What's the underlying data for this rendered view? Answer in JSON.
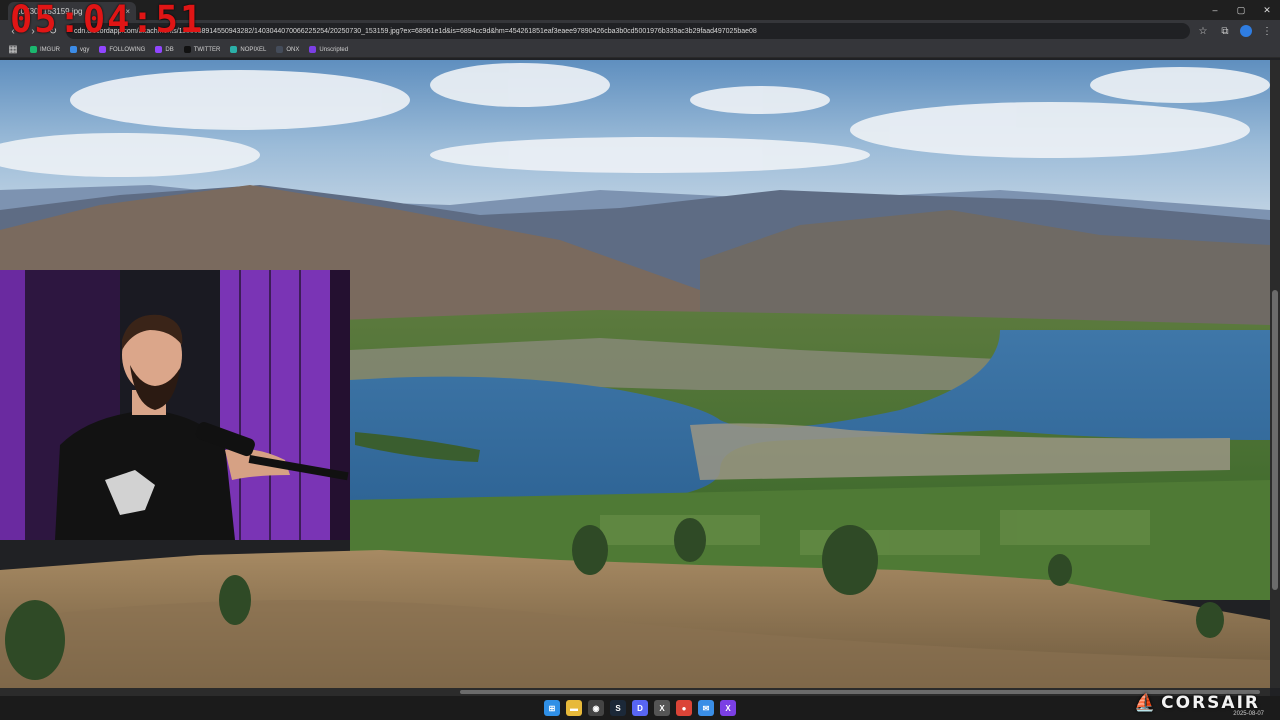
{
  "timer": "05:04:51",
  "browser": {
    "tab_title": "...0730_153159.jpg",
    "tab_close": "×",
    "url": "cdn.discordapp.com/attachments/1133688914550943282/1403044070066225254/20250730_153159.jpg?ex=68961e1d&is=6894cc9d&hm=454261851eaf3eaee97890426cba3b0cd5001976b335ac3b29faad497025bae08",
    "window_controls": [
      "–",
      "▢",
      "✕"
    ],
    "bookmarks": [
      {
        "label": "IMGUR",
        "color": "#1bb76e"
      },
      {
        "label": "vgy",
        "color": "#3c8ce7"
      },
      {
        "label": "FOLLOWING",
        "color": "#9146ff"
      },
      {
        "label": "DB",
        "color": "#9146ff"
      },
      {
        "label": "TWITTER",
        "color": "#111111"
      },
      {
        "label": "NOPIXEL",
        "color": "#2bb0a8"
      },
      {
        "label": "ONX",
        "color": "#444c5a"
      },
      {
        "label": "Unscripted",
        "color": "#7b3fe4"
      }
    ]
  },
  "taskbar": {
    "apps": [
      {
        "name": "start",
        "glyph": "⊞",
        "color": "#2f8fe6"
      },
      {
        "name": "file-explorer",
        "glyph": "▬",
        "color": "#e7b93a"
      },
      {
        "name": "obs",
        "glyph": "◉",
        "color": "#444"
      },
      {
        "name": "steam",
        "glyph": "S",
        "color": "#1b2838"
      },
      {
        "name": "discord",
        "glyph": "D",
        "color": "#5865f2"
      },
      {
        "name": "xsplit",
        "glyph": "X",
        "color": "#555"
      },
      {
        "name": "chrome",
        "glyph": "●",
        "color": "#db4437"
      },
      {
        "name": "mail",
        "glyph": "✉",
        "color": "#3a8ee6"
      },
      {
        "name": "visual-studio",
        "glyph": "X",
        "color": "#7b3fe4"
      }
    ],
    "brand": "CORSAIR",
    "date": "2025-08-07"
  },
  "colors": {
    "timer": "#e01515",
    "webcam_bg": "#2a0d3e"
  }
}
